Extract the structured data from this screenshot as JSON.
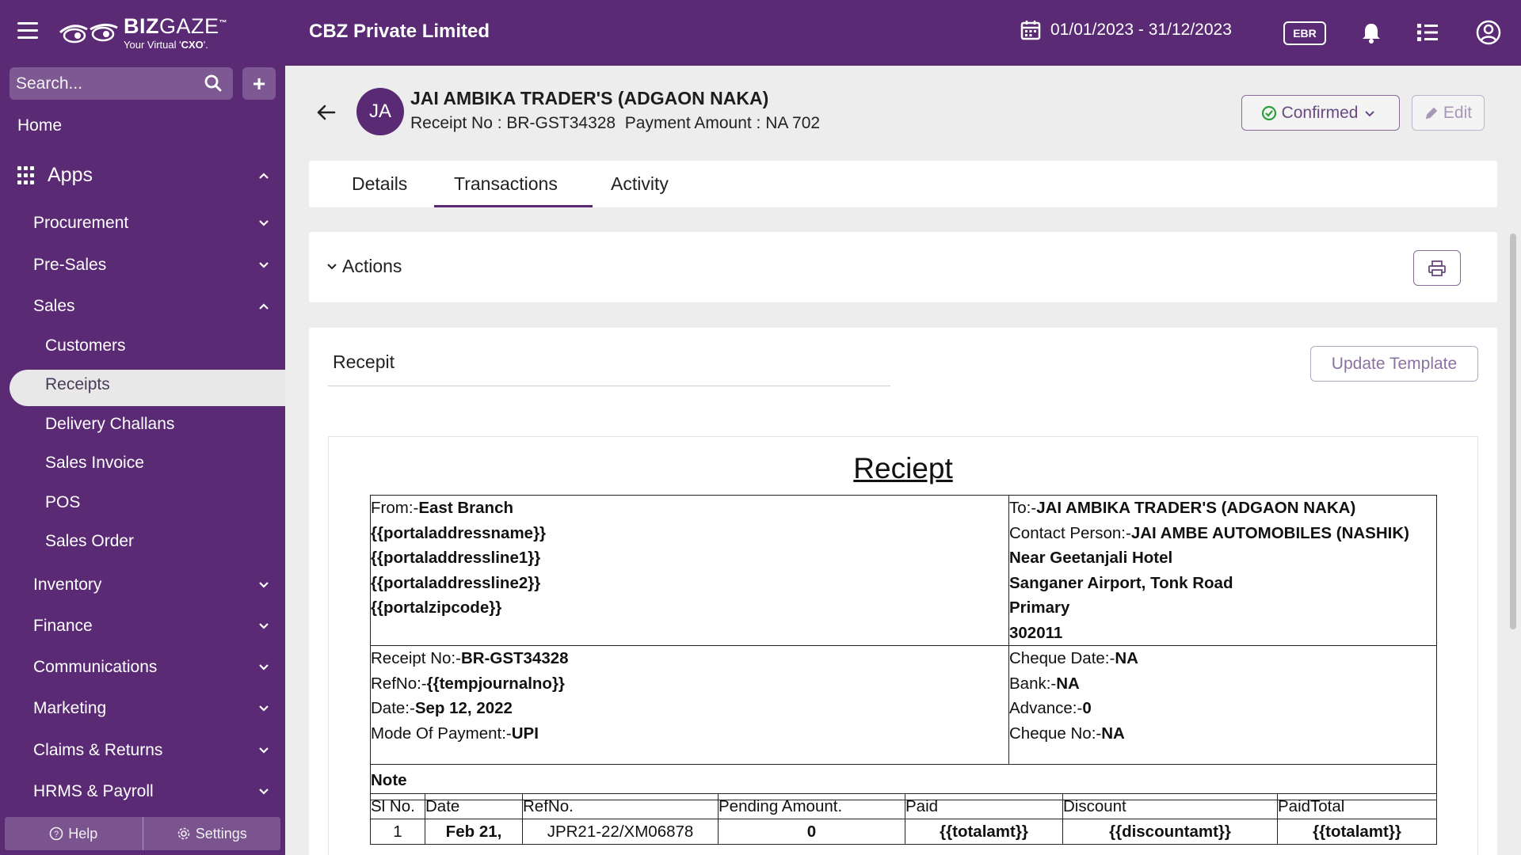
{
  "topbar": {
    "brand_main": "BIZ",
    "brand_thin": "GAZE",
    "brand_tm": "™",
    "brand_tagline_pre": "Your Virtual '",
    "brand_tagline_bold": "CXO",
    "brand_tagline_post": "'.",
    "company": "CBZ Private Limited",
    "date_range": "01/01/2023 - 31/12/2023",
    "ebr_label": "EBR",
    "icons": [
      "menu-icon",
      "calendar-icon",
      "bell-icon",
      "list-icon",
      "user-circle-icon"
    ]
  },
  "sidebar": {
    "search_placeholder": "Search...",
    "plus_label": "+",
    "home": "Home",
    "apps": "Apps",
    "items": [
      {
        "label": "Procurement"
      },
      {
        "label": "Pre-Sales"
      },
      {
        "label": "Sales"
      },
      {
        "label": "Inventory"
      },
      {
        "label": "Finance"
      },
      {
        "label": "Communications"
      },
      {
        "label": "Marketing"
      },
      {
        "label": "Claims & Returns"
      },
      {
        "label": "HRMS & Payroll"
      }
    ],
    "sales_sub": [
      {
        "label": "Customers"
      },
      {
        "label": "Receipts"
      },
      {
        "label": "Delivery Challans"
      },
      {
        "label": "Sales Invoice"
      },
      {
        "label": "POS"
      },
      {
        "label": "Sales Order"
      }
    ],
    "active": "Receipts",
    "footer": {
      "help": "Help",
      "settings": "Settings"
    }
  },
  "record": {
    "initials": "JA",
    "title": "JAI AMBIKA TRADER'S (ADGAON NAKA)",
    "subtitle": "Receipt No : BR-GST34328  Payment Amount : NA 702",
    "status": "Confirmed",
    "edit": "Edit"
  },
  "tabs": [
    {
      "label": "Details"
    },
    {
      "label": "Transactions"
    },
    {
      "label": "Activity"
    }
  ],
  "active_tab": "Transactions",
  "actions": {
    "label": "Actions"
  },
  "template": {
    "title": "Recepit",
    "update_button": "Update Template",
    "heading": "Reciept",
    "from_label": "From:-",
    "from_value": "East Branch",
    "from_lines": [
      "{{portaladdressname}}",
      "{{portaladdressline1}}",
      "{{portaladdressline2}}",
      "{{portalzipcode}}"
    ],
    "to_label": "To:-",
    "to_value": "JAI AMBIKA TRADER'S (ADGAON NAKA)",
    "contact_label": "Contact Person:-",
    "contact_value": "JAI AMBE AUTOMOBILES (NASHIK)",
    "to_lines": [
      "Near Geetanjali Hotel",
      "Sanganer Airport, Tonk Road",
      "Primary",
      "302011"
    ],
    "left_fields": [
      {
        "label": "Receipt No:-",
        "value": "BR-GST34328"
      },
      {
        "label": "RefNo:-",
        "value": "{{tempjournalno}}"
      },
      {
        "label": "Date:-",
        "value": "Sep 12, 2022"
      },
      {
        "label": "Mode Of Payment:-",
        "value": "UPI"
      }
    ],
    "right_fields": [
      {
        "label": "Cheque Date:-",
        "value": "NA"
      },
      {
        "label": "Bank:-",
        "value": "NA"
      },
      {
        "label": "Advance:-",
        "value": "0"
      },
      {
        "label": "Cheque No:-",
        "value": "NA"
      }
    ],
    "note_label": "Note",
    "columns": [
      "Sl No.",
      "Date",
      "RefNo.",
      "Pending Amount.",
      "Paid",
      "Discount",
      "PaidTotal"
    ],
    "rows": [
      {
        "sl": "1",
        "date": "Feb 21,",
        "ref": "JPR21-22/XM06878",
        "pending": "0",
        "paid": "{{totalamt}}",
        "discount": "{{discountamt}}",
        "total": "{{totalamt}}"
      }
    ]
  }
}
